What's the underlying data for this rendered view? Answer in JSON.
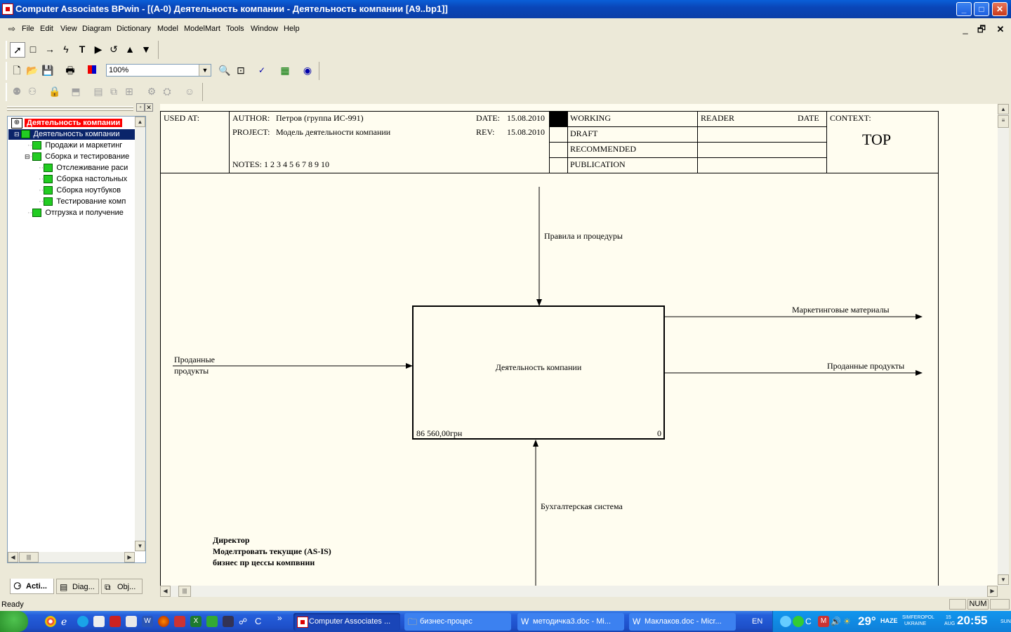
{
  "window": {
    "title": "Computer Associates BPwin - [(A-0) Деятельность компании - Деятельность компании  [A9..bp1]]"
  },
  "menu": [
    "File",
    "Edit",
    "View",
    "Diagram",
    "Dictionary",
    "Model",
    "ModelMart",
    "Tools",
    "Window",
    "Help"
  ],
  "toolbar": {
    "zoom": "100%"
  },
  "tree": {
    "root": "Деятельность компании",
    "items": [
      {
        "label": "Деятельность компании"
      },
      {
        "label": "Продажи и маркетинг"
      },
      {
        "label": "Сборка и тестирование"
      },
      {
        "label": "Отслеживание раси"
      },
      {
        "label": "Сборка настольных"
      },
      {
        "label": "Сборка ноутбуков"
      },
      {
        "label": "Тестирование комп"
      },
      {
        "label": "Отгрузка и получение"
      }
    ]
  },
  "tabs": [
    "Acti...",
    "Diag...",
    "Obj..."
  ],
  "frame": {
    "used_at": "USED AT:",
    "author_label": "AUTHOR:",
    "author": "Петров (группа ИС-991)",
    "project_label": "PROJECT:",
    "project": "Модель деятельности компании",
    "date_label": "DATE:",
    "date": "15.08.2010",
    "rev_label": "REV:",
    "rev": "15.08.2010",
    "notes": "NOTES:  1  2  3  4  5  6  7  8  9  10",
    "status": [
      "WORKING",
      "DRAFT",
      "RECOMMENDED",
      "PUBLICATION"
    ],
    "reader": "READER",
    "reader_date": "DATE",
    "context": "CONTEXT:",
    "context_value": "TOP"
  },
  "diagram": {
    "box_label": "Деятельность компании",
    "box_cost": "86 560,00грн",
    "box_number": "0",
    "control": "Правила и процедуры",
    "input": "Проданные\nпродукты",
    "output1": "Маркетинговые материалы",
    "output2": "Проданные продукты",
    "mechanism": "Бухгалтерская система",
    "note": "Директор\nМоделтровать текущие (AS-IS)\nбизнес пр цессы компвнии"
  },
  "status": {
    "text": "Ready",
    "num": "NUM"
  },
  "taskbar": {
    "tasks": [
      "Computer Associates ...",
      "бизнес-процес",
      "методичка3.doc - Mi...",
      "Маклаков.doc - Micr..."
    ],
    "lang": "EN",
    "temp": "29°",
    "weather": "HAZE",
    "city": "SIMFEROPOL",
    "country": "UKRAINE",
    "day": "15",
    "month": "AUG",
    "time": "20:55",
    "weekday": "SUN"
  }
}
